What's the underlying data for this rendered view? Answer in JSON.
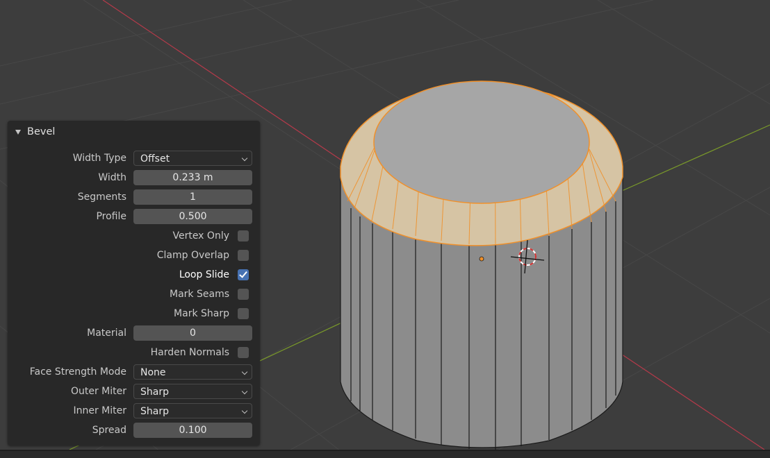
{
  "panel": {
    "title": "Bevel",
    "width_type": {
      "label": "Width Type",
      "value": "Offset"
    },
    "width": {
      "label": "Width",
      "value": "0.233 m"
    },
    "segments": {
      "label": "Segments",
      "value": "1"
    },
    "profile": {
      "label": "Profile",
      "value": "0.500"
    },
    "vertex_only": {
      "label": "Vertex Only",
      "checked": false
    },
    "clamp_overlap": {
      "label": "Clamp Overlap",
      "checked": false
    },
    "loop_slide": {
      "label": "Loop Slide",
      "checked": true
    },
    "mark_seams": {
      "label": "Mark Seams",
      "checked": false
    },
    "mark_sharp": {
      "label": "Mark Sharp",
      "checked": false
    },
    "material": {
      "label": "Material",
      "value": "0"
    },
    "harden_normals": {
      "label": "Harden Normals",
      "checked": false
    },
    "face_strength_mode": {
      "label": "Face Strength Mode",
      "value": "None"
    },
    "outer_miter": {
      "label": "Outer Miter",
      "value": "Sharp"
    },
    "inner_miter": {
      "label": "Inner Miter",
      "value": "Sharp"
    },
    "spread": {
      "label": "Spread",
      "value": "0.100"
    }
  },
  "colors": {
    "background": "#3d3d3d",
    "panel": "#282828",
    "accent_checkbox": "#4772b3",
    "x_axis": "#b53a4a",
    "y_axis": "#7a9a2a",
    "selection_orange": "#f0902a"
  }
}
